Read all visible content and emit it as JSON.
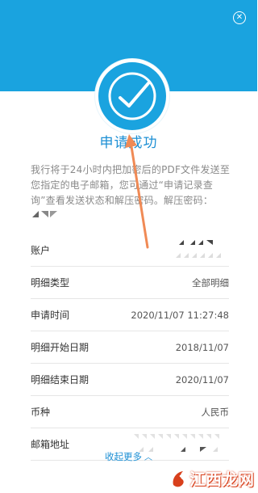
{
  "header": {
    "close_icon": "close-icon"
  },
  "status": {
    "title": "申请成功",
    "icon": "check-circle-icon"
  },
  "notice": {
    "text": "我行将于24小时内把加密后的PDF文件发送至您指定的电子邮箱，您可通过“申请记录查询”查看发送状态和解压密码。解压密码："
  },
  "rows": [
    {
      "label": "账户",
      "value": ""
    },
    {
      "label": "明细类型",
      "value": "全部明细"
    },
    {
      "label": "申请时间",
      "value": "2020/11/07 11:27:48"
    },
    {
      "label": "明细开始日期",
      "value": "2018/11/07"
    },
    {
      "label": "明细结束日期",
      "value": "2020/11/07"
    },
    {
      "label": "币种",
      "value": "人民币"
    },
    {
      "label": "邮箱地址",
      "value": ""
    }
  ],
  "footer": {
    "more_label": "收起更多",
    "more_icon": "chevron-up-icon"
  },
  "watermark": {
    "text": "江西龙网",
    "logo": "dragon-logo"
  },
  "colors": {
    "accent": "#1aa3df",
    "title": "#1c8fd4",
    "arrow": "#f08a55"
  }
}
